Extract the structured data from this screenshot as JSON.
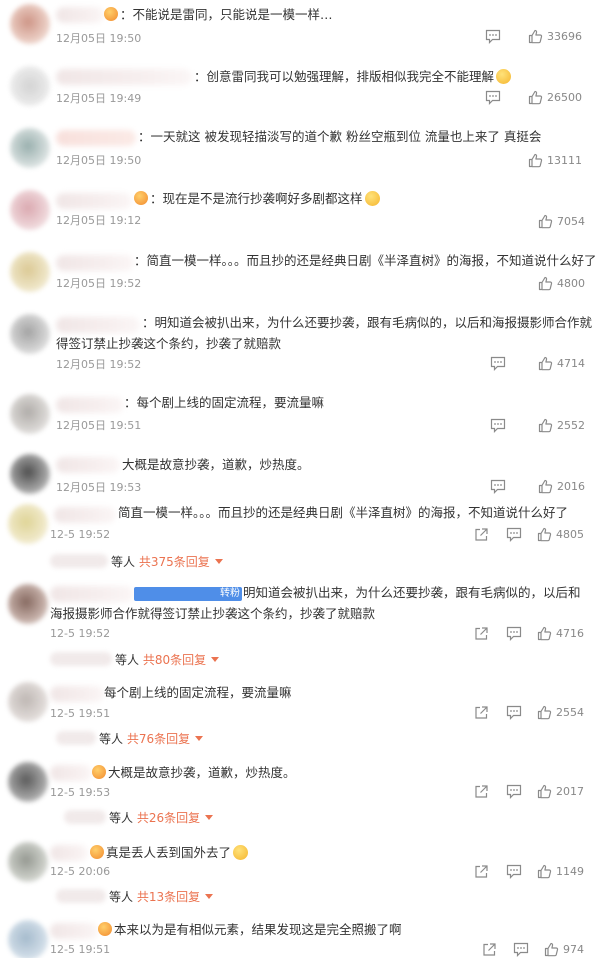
{
  "comments": [
    {
      "text": "：不能说是雷同，只能说是一模一样…",
      "time": "12月05日 19:50",
      "likes": "33696"
    },
    {
      "text": "：创意雷同我可以勉强理解，排版相似我完全不能理解",
      "time": "12月05日 19:49",
      "likes": "26500"
    },
    {
      "text": "：一天就这 被发现轻描淡写的道个歉 粉丝空瓶到位 流量也上来了 真挺会",
      "time": "12月05日 19:50",
      "likes": "13111"
    },
    {
      "text": "：现在是不是流行抄袭啊好多剧都这样",
      "time": "12月05日 19:12",
      "likes": "7054"
    },
    {
      "text": "：简直一模一样。。。而且抄的还是经典日剧《半泽直树》的海报，不知道说什么好了",
      "time": "12月05日 19:52",
      "likes": "4800"
    },
    {
      "text": "：明知道会被扒出来，为什么还要抄袭，跟有毛病似的，以后和海报摄影师合作就得签订禁止抄袭这个条约，抄袭了就赔款",
      "time": "12月05日 19:52",
      "likes": "4714"
    },
    {
      "text": "：每个剧上线的固定流程，要流量嘛",
      "time": "12月05日 19:51",
      "likes": "2552"
    },
    {
      "text": "大概是故意抄袭，道歉，炒热度。",
      "time": "12月05日 19:53",
      "likes": "2016"
    }
  ],
  "threads": [
    {
      "text": "简直一模一样。。。而且抄的还是经典日剧《半泽直树》的海报，不知道说什么好了",
      "time": "12-5 19:52",
      "likes": "4805",
      "replies_prefix": "等人",
      "replies": "共375条回复"
    },
    {
      "tag": "转粉",
      "text": "明知道会被扒出来，为什么还要抄袭，跟有毛病似的，以后和海报摄影师合作就得签订禁止抄袭这个条约，抄袭了就赔款",
      "time": "12-5 19:52",
      "likes": "4716",
      "replies_prefix": "等人",
      "replies": "共80条回复"
    },
    {
      "text": "每个剧上线的固定流程，要流量嘛",
      "time": "12-5 19:51",
      "likes": "2554",
      "replies_prefix": "等人",
      "replies": "共76条回复"
    },
    {
      "text": "大概是故意抄袭，道歉，炒热度。",
      "time": "12-5 19:53",
      "likes": "2017",
      "replies_prefix": "等人",
      "replies": "共26条回复"
    },
    {
      "text": "真是丢人丢到国外去了",
      "time": "12-5 20:06",
      "likes": "1149",
      "replies_prefix": "等人",
      "replies": "共13条回复"
    },
    {
      "text": "本来以为是有相似元素，结果发现这是完全照搬了啊",
      "time": "12-5 19:51",
      "likes": "974"
    }
  ],
  "colors": {
    "accent": "#eb7350",
    "muted": "#999999",
    "text": "#333333",
    "tag": "#4f8ee8"
  },
  "icons": {
    "comment": "comment-icon",
    "like": "thumbs-up-icon",
    "share": "share-icon"
  }
}
